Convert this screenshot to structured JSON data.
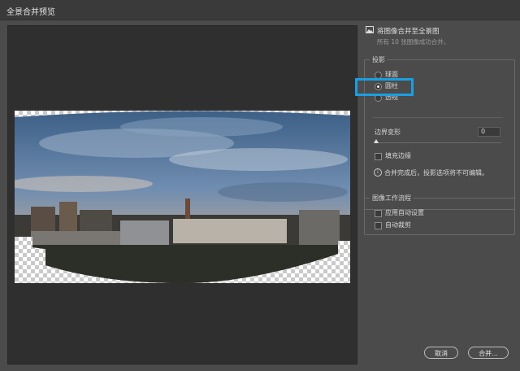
{
  "window": {
    "title": "全景合并预览"
  },
  "merge": {
    "label": "将图像合并至全景图",
    "status": "所有 10 张图像成功合并。"
  },
  "projection": {
    "legend": "投影",
    "options": [
      {
        "label": "球面",
        "selected": false
      },
      {
        "label": "圆柱",
        "selected": true
      },
      {
        "label": "透视",
        "selected": false
      }
    ]
  },
  "boundary_warp": {
    "label": "边界变形",
    "value": "0"
  },
  "fill_edges": {
    "label": "填充边缘",
    "checked": false
  },
  "info_note": "合并完成后，投影选项将不可编辑。",
  "workflow": {
    "legend": "图像工作流程",
    "options": [
      {
        "label": "应用自动设置",
        "checked": false
      },
      {
        "label": "自动裁剪",
        "checked": false
      }
    ]
  },
  "buttons": {
    "cancel": "取消",
    "merge": "合并..."
  },
  "colors": {
    "highlight": "#1a9fe2",
    "panel": "#4b4b4b",
    "preview_bg": "#2f2f2f"
  },
  "icons": {
    "merge_icon": "panorama-image-icon",
    "info_icon": "info-icon"
  }
}
